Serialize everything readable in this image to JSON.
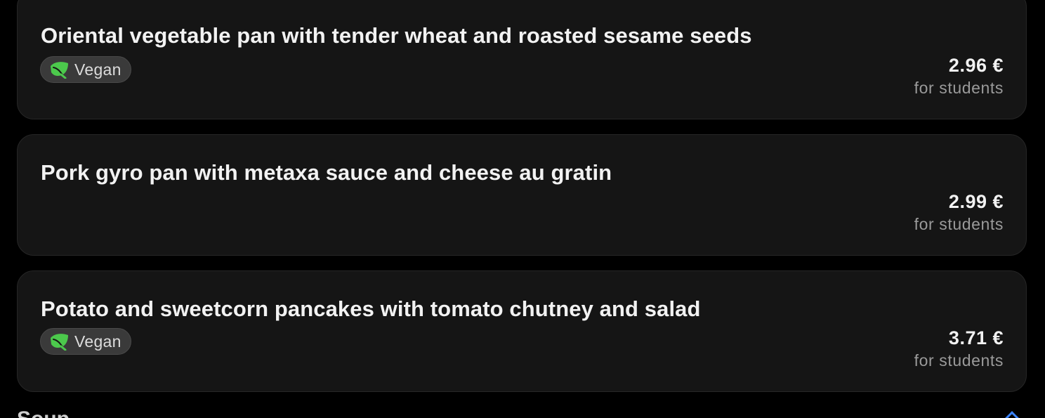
{
  "colors": {
    "background": "#000000",
    "card": "#151515",
    "badge": "#3a3a3a",
    "leaf": "#4cc94c",
    "accent": "#3b82f6"
  },
  "meals": [
    {
      "name": "Oriental vegetable pan with tender wheat and roasted sesame seeds",
      "badge": {
        "icon": "leaf-icon",
        "label": "Vegan"
      },
      "price": "2.96 €",
      "price_note": "for students"
    },
    {
      "name": "Pork gyro pan with metaxa sauce and cheese au gratin",
      "price": "2.99 €",
      "price_note": "for students"
    },
    {
      "name": "Potato and sweetcorn pancakes with tomato chutney and salad",
      "badge": {
        "icon": "leaf-icon",
        "label": "Vegan"
      },
      "price": "3.71 €",
      "price_note": "for students"
    }
  ],
  "next_section": {
    "title": "Soup",
    "icon": "chevron-up-icon"
  }
}
